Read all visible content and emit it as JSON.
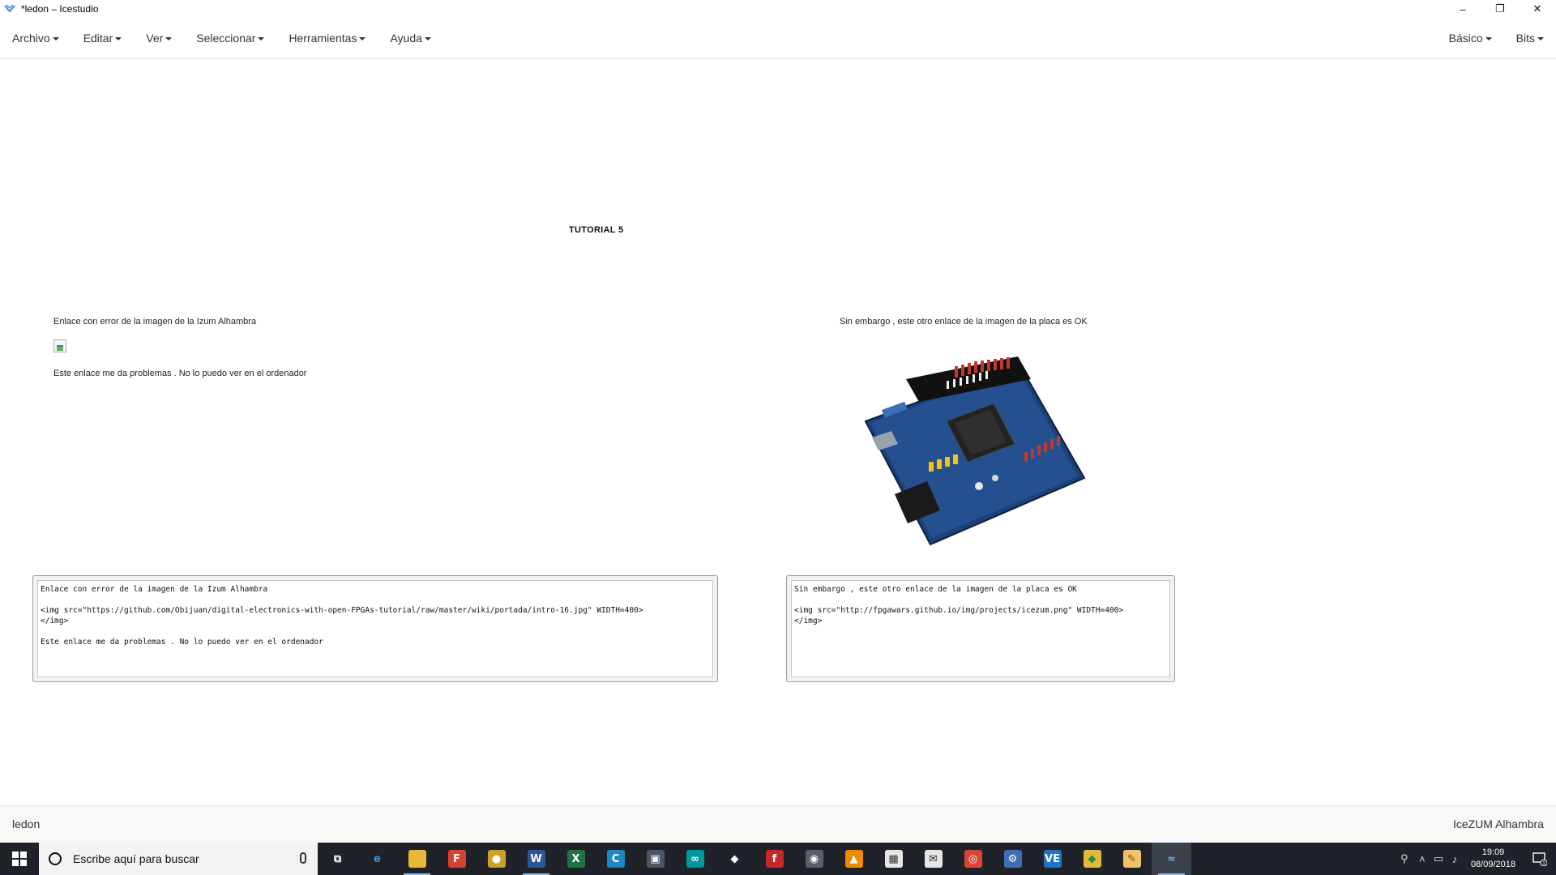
{
  "window": {
    "title": "*ledon – Icestudio",
    "controls": {
      "minimize": "–",
      "maximize": "❐",
      "close": "✕"
    }
  },
  "menu": {
    "left": [
      "Archivo",
      "Editar",
      "Ver",
      "Seleccionar",
      "Herramientas",
      "Ayuda"
    ],
    "right": [
      "Básico",
      "Bits"
    ]
  },
  "canvas": {
    "title": "TUTORIAL 5",
    "left_info": {
      "caption": "Enlace con error de la imagen de la Izum Alhambra",
      "note": "Este enlace me da problemas . No lo puedo ver en el ordenador"
    },
    "right_info": {
      "caption": "Sin embargo , este otro enlace de la imagen de la placa es OK"
    },
    "editor_left": "Enlace con error de la imagen de la Izum Alhambra\n\n<img src=\"https://github.com/Obijuan/digital-electronics-with-open-FPGAs-tutorial/raw/master/wiki/portada/intro-16.jpg\" WIDTH=400>\n</img>\n\nEste enlace me da problemas . No lo puedo ver en el ordenador",
    "editor_right": "Sin embargo , este otro enlace de la imagen de la placa es OK\n\n<img src=\"http://fpgawars.github.io/img/projects/icezum.png\" WIDTH=400>\n</img>"
  },
  "status": {
    "left": "ledon",
    "right": "IceZUM Alhambra"
  },
  "taskbar": {
    "search_placeholder": "Escribe aquí para buscar",
    "time": "19:09",
    "date": "08/09/2018",
    "notification_count": "1",
    "apps": [
      {
        "name": "task-view-icon",
        "color": "#1f2228",
        "label": "⧉"
      },
      {
        "name": "edge-icon",
        "color": "#1f2228",
        "label": "e",
        "fg": "#3a8ee6"
      },
      {
        "name": "file-explorer-icon",
        "color": "#e8b838",
        "label": ""
      },
      {
        "name": "foxit-icon",
        "color": "#d64232",
        "label": "F"
      },
      {
        "name": "globe-app-icon",
        "color": "#c9a227",
        "label": "●"
      },
      {
        "name": "word-icon",
        "color": "#2b579a",
        "label": "W"
      },
      {
        "name": "excel-icon",
        "color": "#217346",
        "label": "X"
      },
      {
        "name": "cortana-c-icon",
        "color": "#1e88c7",
        "label": "C"
      },
      {
        "name": "terminal-icon",
        "color": "#4a5566",
        "label": "▣"
      },
      {
        "name": "arduino-icon",
        "color": "#00979c",
        "label": "∞"
      },
      {
        "name": "inkscape-icon",
        "color": "#1f2228",
        "label": "◆"
      },
      {
        "name": "fritzing-icon",
        "color": "#c62828",
        "label": "f"
      },
      {
        "name": "gamepad-icon",
        "color": "#5a5f68",
        "label": "◉"
      },
      {
        "name": "vlc-icon",
        "color": "#f08a00",
        "label": "▲"
      },
      {
        "name": "calculator-icon",
        "color": "#e6e6e6",
        "label": "▦",
        "fg": "#333"
      },
      {
        "name": "mail-icon",
        "color": "#e6e6e6",
        "label": "✉",
        "fg": "#333"
      },
      {
        "name": "chrome-icon",
        "color": "#db4437",
        "label": "◎"
      },
      {
        "name": "network-app-icon",
        "color": "#3d6fb6",
        "label": "⚙"
      },
      {
        "name": "vscode-icon",
        "color": "#1f74c9",
        "label": "VE"
      },
      {
        "name": "git-icon",
        "color": "#e2b93b",
        "label": "◆",
        "fg": "#2a8f3c"
      },
      {
        "name": "notepad-icon",
        "color": "#f0c36b",
        "label": "✎",
        "fg": "#7a4a12"
      },
      {
        "name": "icestudio-icon",
        "color": "#3b414b",
        "label": "≈",
        "fg": "#6fb3e8"
      }
    ]
  }
}
